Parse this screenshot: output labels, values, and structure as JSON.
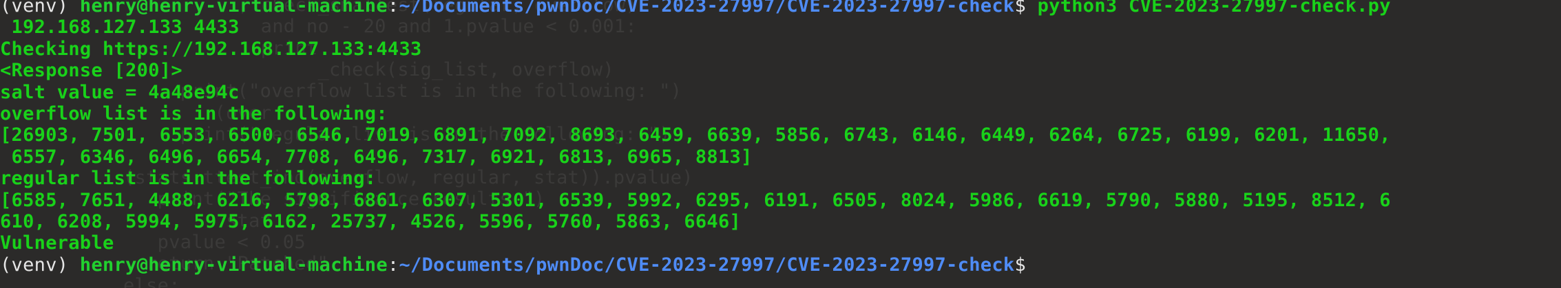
{
  "prompt": {
    "venv": "(venv) ",
    "user_host": "henry@henry-virtual-machine",
    "sep": ":",
    "path": "~/Documents/pwnDoc/CVE-2023-27997/CVE-2023-27997-check",
    "dollar": "$ "
  },
  "command": "python3 CVE-2023-27997-check.py",
  "command_cont": " 192.168.127.133 4433",
  "output": [
    "Checking https://192.168.127.133:4433",
    "<Response [200]>",
    "salt value = 4a48e94c",
    "overflow list is in the following:",
    "[26903, 7501, 6553, 6500, 6546, 7019, 6891, 7092, 8693, 6459, 6639, 5856, 6743, 6146, 6449, 6264, 6725, 6199, 6201, 11650,",
    " 6557, 6346, 6496, 6654, 7708, 6496, 7317, 6921, 6813, 6965, 8813]",
    "regular list is in the following:",
    "[6585, 7651, 4488, 6216, 5798, 6861, 6307, 5301, 6539, 5992, 6295, 6191, 6505, 8024, 5986, 6619, 5790, 5880, 5195, 8512, 6",
    "610, 6208, 5994, 5975, 6162, 25737, 4526, 5596, 5760, 5863, 6646]",
    "Vulnerable"
  ],
  "ghost_lines": [
    "          , check_smallest(regular, overflow)",
    "            and no - 20 and 1.pvalue < 0.001:",
    "            print",
    "                 _check(sig_list, overflow)",
    "              print(\"overflow list is in the following: \")",
    "                 (over",
    "              print(\"regular list is in the following: \")",
    "",
    "         (stats.ttest_ind(overflow, regular, stat)).pvalue)",
    "            print(\"The significance results.\")",
    "                  stat",
    "            pvalue < 0.05",
    "           return \"Patched\"",
    "         else:"
  ]
}
